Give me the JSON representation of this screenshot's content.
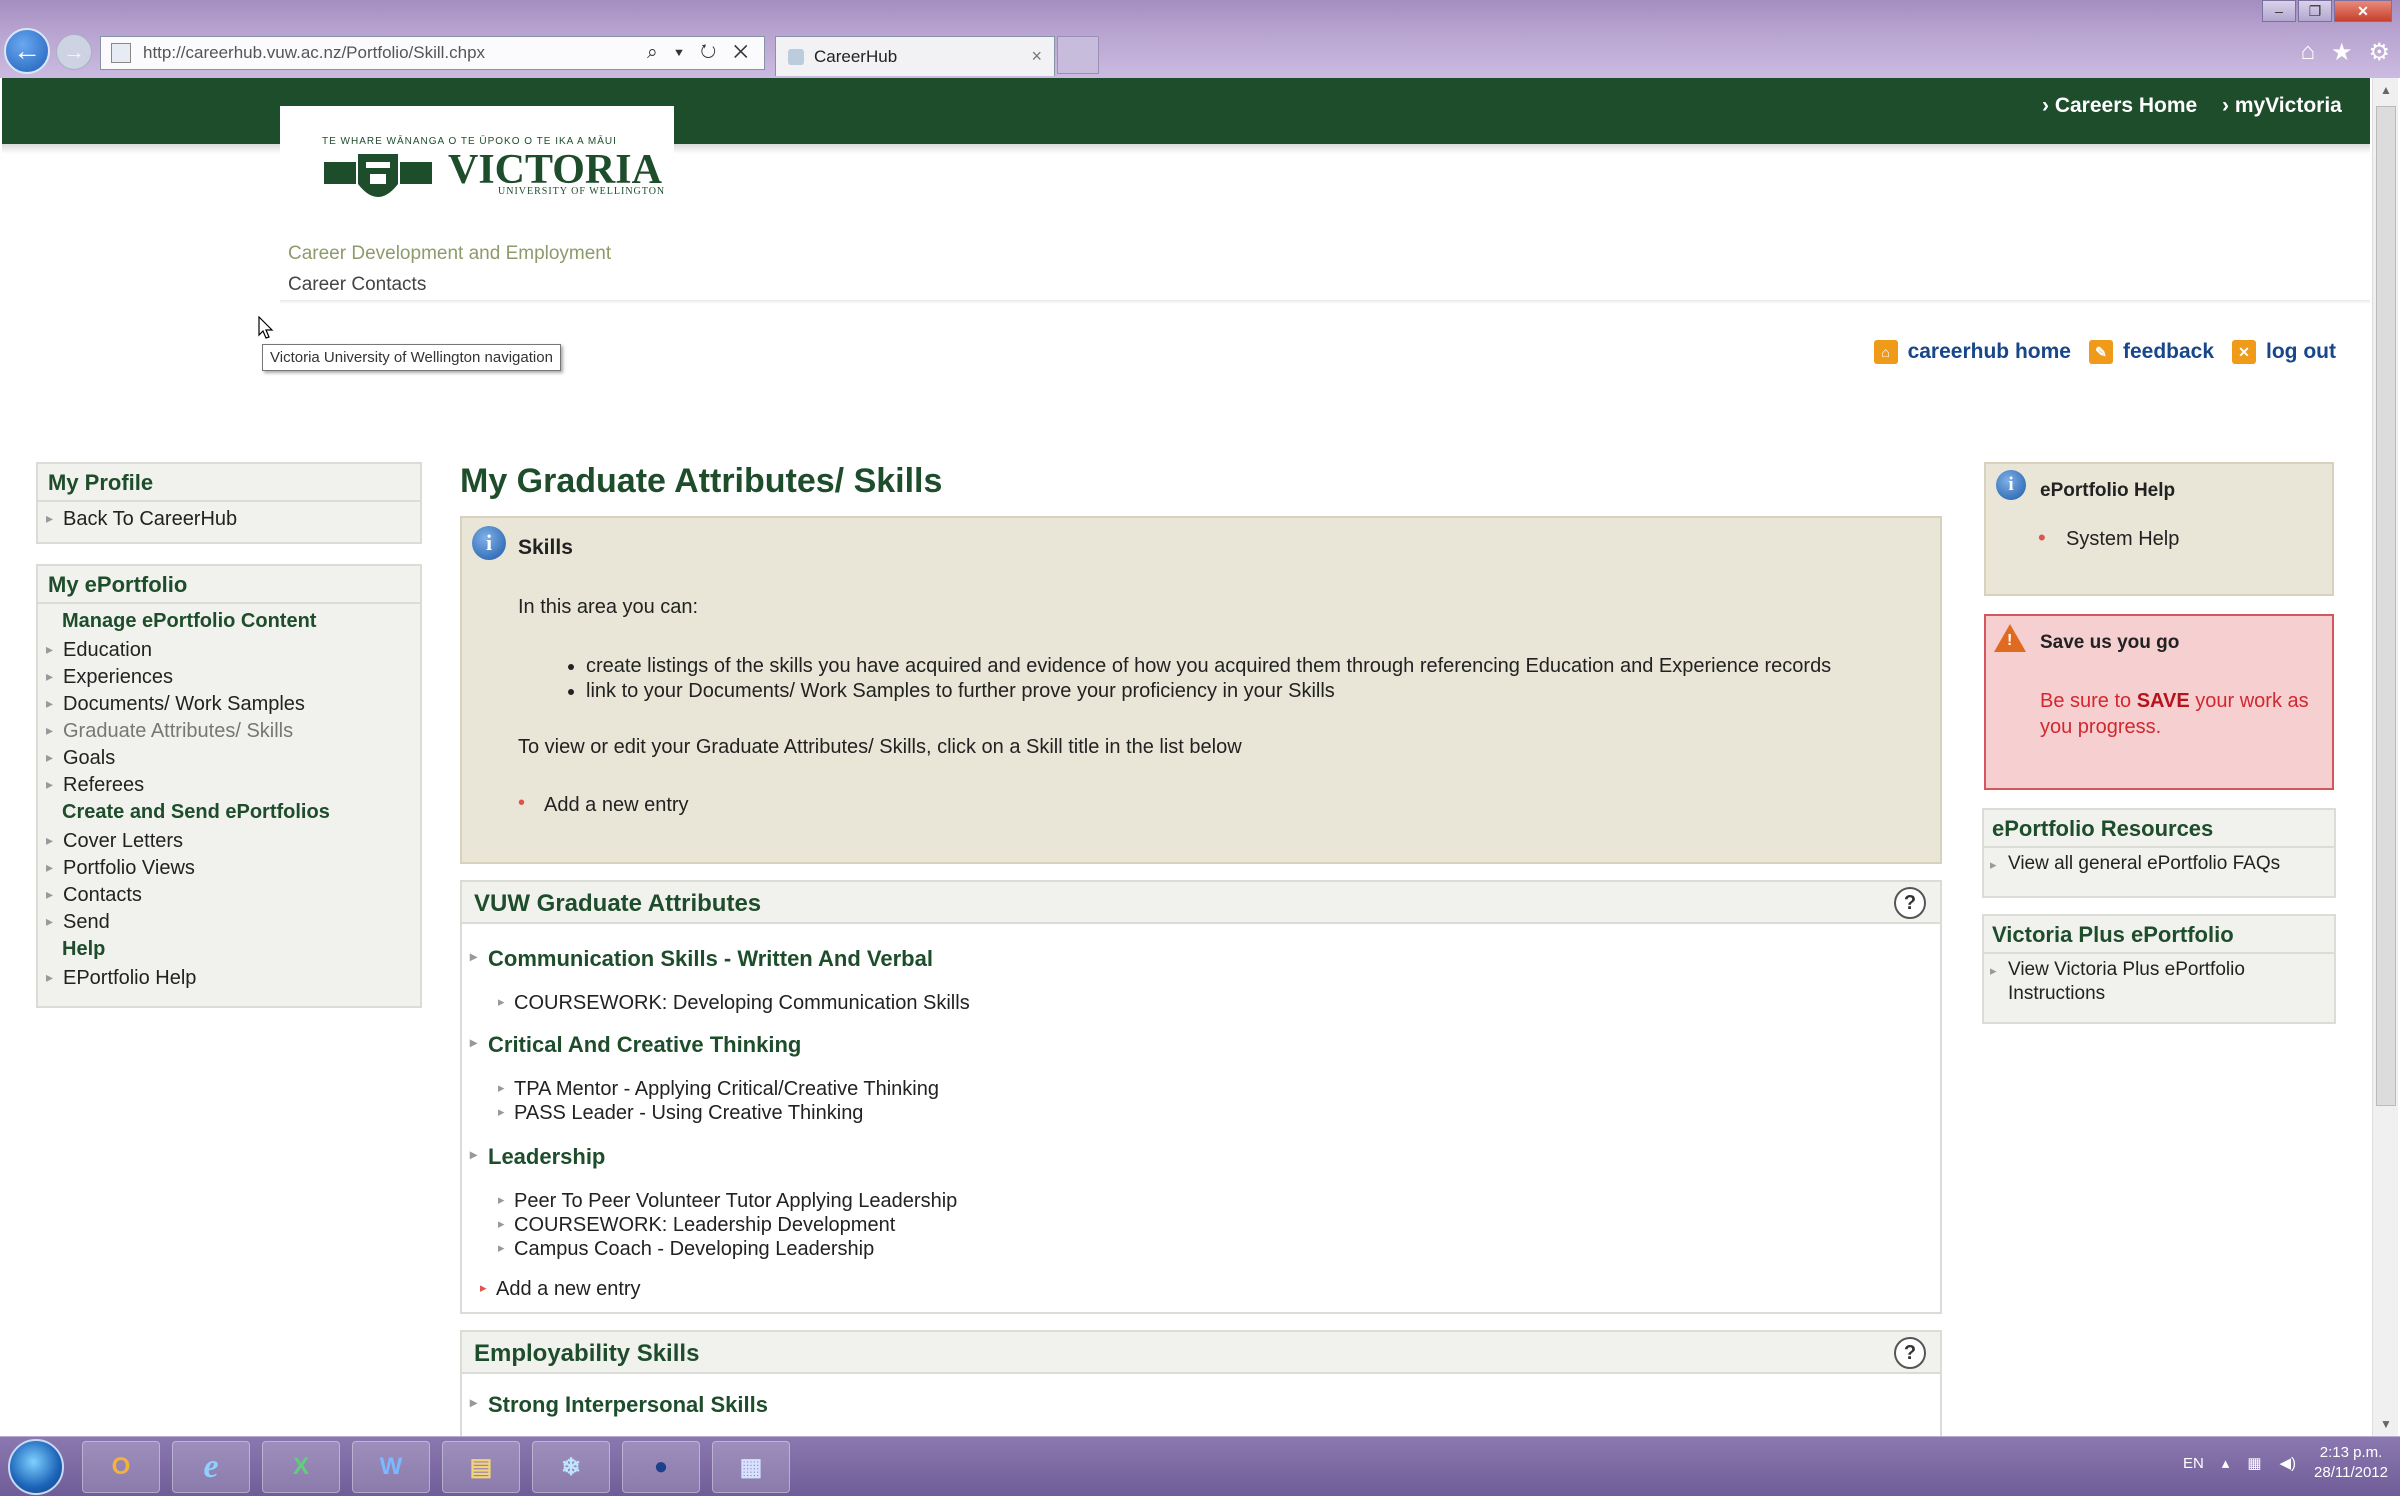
{
  "browser": {
    "url": "http://careerhub.vuw.ac.nz/Portfolio/Skill.chpx",
    "tab_title": "CareerHub",
    "tab_close": "×",
    "addr_tools": "⌕ ▾ ↻ ✕"
  },
  "header": {
    "links": [
      "› Careers Home",
      "› myVictoria"
    ],
    "logo_motto": "TE WHARE WĀNANGA O TE ŪPOKO O TE IKA A MĀUI",
    "logo_name": "VICTORIA",
    "logo_sub": "UNIVERSITY OF WELLINGTON",
    "dept": "Career Development and Employment",
    "contacts": "Career Contacts",
    "tooltip": "Victoria University of Wellington navigation"
  },
  "utility": {
    "home": "careerhub home",
    "feedback": "feedback",
    "logout": "log out"
  },
  "sidebar": {
    "profile_title": "My Profile",
    "profile_items": [
      "Back To CareerHub"
    ],
    "eportfolio_title": "My ePortfolio",
    "manage_head": "Manage ePortfolio Content",
    "manage_items": [
      "Education",
      "Experiences",
      "Documents/ Work Samples",
      "Graduate Attributes/ Skills",
      "Goals",
      "Referees"
    ],
    "create_head": "Create and Send ePortfolios",
    "create_items": [
      "Cover Letters",
      "Portfolio Views",
      "Contacts",
      "Send"
    ],
    "help_head": "Help",
    "help_items": [
      "EPortfolio Help"
    ]
  },
  "main": {
    "title": "My Graduate Attributes/ Skills",
    "info": {
      "title": "Skills",
      "intro": "In this area you can:",
      "bullets": [
        "create listings of the skills you have acquired and evidence of how you acquired them through referencing Education and Experience records",
        "link to your Documents/ Work Samples to further prove your proficiency in your Skills"
      ],
      "view_text": "To view or edit your Graduate Attributes/ Skills, click on a Skill title in the list below",
      "add_entry": "Add a new entry"
    },
    "graduate_section": {
      "title": "VUW Graduate Attributes",
      "help": "?",
      "attributes": [
        {
          "name": "Communication Skills - Written And Verbal",
          "items": [
            "COURSEWORK: Developing Communication Skills"
          ]
        },
        {
          "name": "Critical And Creative Thinking",
          "items": [
            "TPA Mentor - Applying Critical/Creative Thinking",
            "PASS Leader - Using Creative Thinking"
          ]
        },
        {
          "name": "Leadership",
          "items": [
            "Peer To Peer Volunteer Tutor Applying Leadership",
            "COURSEWORK: Leadership Development",
            "Campus Coach - Developing Leadership"
          ]
        }
      ],
      "add_entry": "Add a new entry"
    },
    "employability_section": {
      "title": "Employability Skills",
      "help": "?",
      "attributes": [
        {
          "name": "Strong Interpersonal Skills"
        }
      ]
    }
  },
  "right": {
    "help_title": "ePortfolio Help",
    "help_item": "System Help",
    "warn_title": "Save us you go",
    "warn_pre": "Be sure to ",
    "warn_bold": "SAVE",
    "warn_post": " your work as you progress.",
    "resources_title": "ePortfolio Resources",
    "resources_item": "View all general ePortfolio FAQs",
    "plus_title": "Victoria Plus ePortfolio",
    "plus_item": "View Victoria Plus ePortfolio Instructions"
  },
  "taskbar": {
    "apps": [
      "O",
      "e",
      "X",
      "W",
      "▤",
      "❄",
      "●",
      "▦"
    ],
    "lang": "EN",
    "time": "2:13 p.m.",
    "date": "28/11/2012"
  },
  "colors": {
    "brand_green": "#1e4d2b",
    "link_blue": "#17478a",
    "accent_orange": "#f09a1a",
    "warn_red": "#d1282f"
  }
}
